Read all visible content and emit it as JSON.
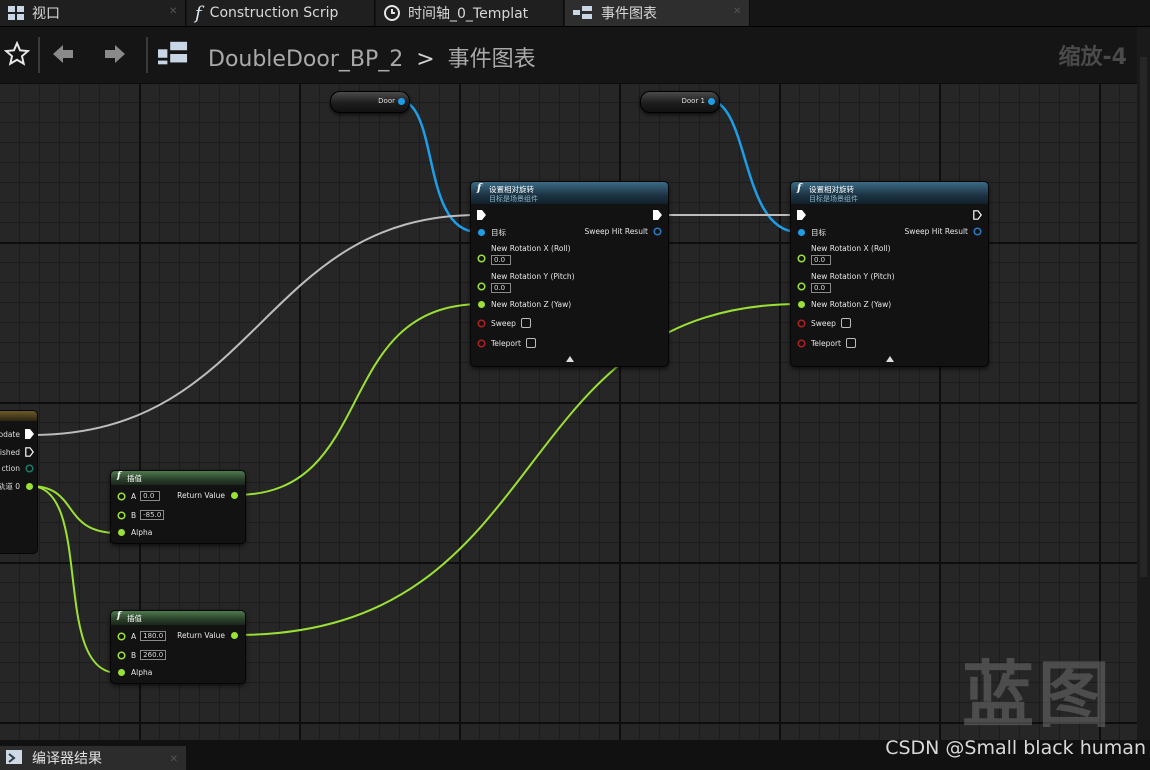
{
  "tabs": [
    {
      "label": "视口",
      "icon": "viewport-icon"
    },
    {
      "label": "Construction Scrip",
      "icon": "function-icon"
    },
    {
      "label": "时间轴_0_Templat",
      "icon": "clock-icon"
    },
    {
      "label": "事件图表",
      "icon": "event-graph-icon",
      "active": true
    }
  ],
  "toolbar": {
    "breadcrumb_root": "DoubleDoor_BP_2",
    "breadcrumb_sep": ">",
    "breadcrumb_current": "事件图表",
    "zoom": "缩放-4"
  },
  "getters": [
    {
      "label": "Door"
    },
    {
      "label": "Door 1"
    }
  ],
  "set_rotation_nodes": [
    {
      "title": "设置相对旋转",
      "subtitle": "目标是场景组件",
      "target": "目标",
      "sweep_hit": "Sweep Hit Result",
      "rot_x": "New Rotation X (Roll)",
      "rot_x_val": "0.0",
      "rot_y": "New Rotation Y (Pitch)",
      "rot_y_val": "0.0",
      "rot_z": "New Rotation Z (Yaw)",
      "sweep": "Sweep",
      "teleport": "Teleport"
    },
    {
      "title": "设置相对旋转",
      "subtitle": "目标是场景组件",
      "target": "目标",
      "sweep_hit": "Sweep Hit Result",
      "rot_x": "New Rotation X (Roll)",
      "rot_x_val": "0.0",
      "rot_y": "New Rotation Y (Pitch)",
      "rot_y_val": "0.0",
      "rot_z": "New Rotation Z (Yaw)",
      "sweep": "Sweep",
      "teleport": "Teleport"
    }
  ],
  "lerp_nodes": [
    {
      "title": "插值",
      "a_label": "A",
      "a_val": "0.0",
      "b_label": "B",
      "b_val": "-85.0",
      "alpha": "Alpha",
      "ret": "Return Value"
    },
    {
      "title": "插值",
      "a_label": "A",
      "a_val": "180.0",
      "b_label": "B",
      "b_val": "260.0",
      "alpha": "Alpha",
      "ret": "Return Value"
    }
  ],
  "timeline_node": {
    "update": "pdate",
    "finished": "ished",
    "direction": "ction",
    "track": "轨道 0"
  },
  "bottom_tab": {
    "label": "编译器结果"
  },
  "watermark": "蓝图",
  "credit": "CSDN @Small black human",
  "colors": {
    "exec": "#ffffff",
    "object_pin": "#1e9ee8",
    "float_pin": "#9be135",
    "bool_pin": "#9b1b1b",
    "struct_pin": "#2b78c9"
  }
}
